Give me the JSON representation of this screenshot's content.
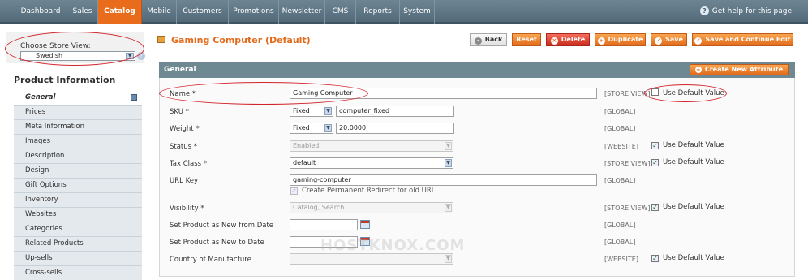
{
  "nav": {
    "items": [
      "Dashboard",
      "Sales",
      "Catalog",
      "Mobile",
      "Customers",
      "Promotions",
      "Newsletter",
      "CMS",
      "Reports",
      "System"
    ],
    "help": "Get help for this page"
  },
  "store_view": {
    "label": "Choose Store View:",
    "selected": "Swedish"
  },
  "sidebar": {
    "title": "Product Information",
    "items": [
      "General",
      "Prices",
      "Meta Information",
      "Images",
      "Description",
      "Design",
      "Gift Options",
      "Inventory",
      "Websites",
      "Categories",
      "Related Products",
      "Up-sells",
      "Cross-sells"
    ]
  },
  "header": {
    "title": "Gaming Computer (Default)",
    "buttons": {
      "back": "Back",
      "reset": "Reset",
      "delete": "Delete",
      "duplicate": "Duplicate",
      "save": "Save",
      "save_continue": "Save and Continue Edit"
    }
  },
  "section": {
    "title": "General",
    "create_attribute": "Create New Attribute"
  },
  "use_default_label": "Use Default Value",
  "form": {
    "name": {
      "label": "Name *",
      "value": "Gaming Computer",
      "scope": "[STORE VIEW]",
      "use_default": false
    },
    "sku": {
      "label": "SKU *",
      "type": "Fixed",
      "value": "computer_fixed",
      "scope": "[GLOBAL]"
    },
    "weight": {
      "label": "Weight *",
      "type": "Fixed",
      "value": "20.0000",
      "scope": "[GLOBAL]"
    },
    "status": {
      "label": "Status *",
      "value": "Enabled",
      "scope": "[WEBSITE]",
      "use_default": true
    },
    "tax_class": {
      "label": "Tax Class *",
      "value": "default",
      "scope": "[STORE VIEW]",
      "use_default": true
    },
    "url_key": {
      "label": "URL Key",
      "value": "gaming-computer",
      "scope": "[GLOBAL]",
      "redirect": "Create Permanent Redirect for old URL"
    },
    "visibility": {
      "label": "Visibility *",
      "value": "Catalog, Search",
      "scope": "[STORE VIEW]",
      "use_default": true
    },
    "new_from": {
      "label": "Set Product as New from Date",
      "value": "",
      "scope": "[GLOBAL]"
    },
    "new_to": {
      "label": "Set Product as New to Date",
      "value": "",
      "scope": "[GLOBAL]"
    },
    "country": {
      "label": "Country of Manufacture",
      "value": "",
      "scope": "[WEBSITE]",
      "use_default": true
    }
  },
  "watermark": "HOSTKNOX.COM",
  "colors": {
    "accent": "#e26b1c",
    "nav_bg": "#5d7482",
    "annotation": "#d2232a"
  }
}
